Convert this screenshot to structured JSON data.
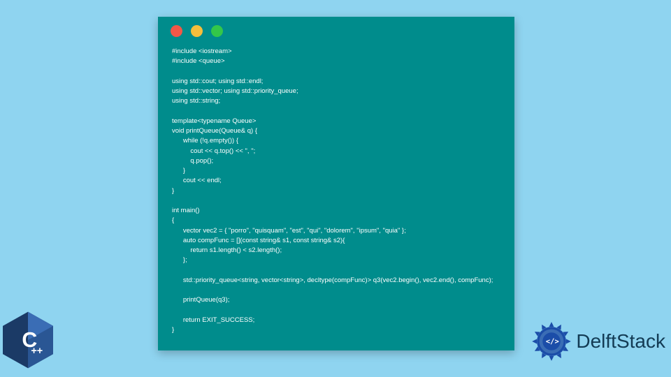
{
  "window": {
    "dots": {
      "red": "#f35747",
      "yellow": "#f6be3c",
      "green": "#33c74a"
    }
  },
  "code": "#include <iostream>\n#include <queue>\n\nusing std::cout; using std::endl;\nusing std::vector; using std::priority_queue;\nusing std::string;\n\ntemplate<typename Queue>\nvoid printQueue(Queue& q) {\n      while (!q.empty()) {\n          cout << q.top() << \", \";\n          q.pop();\n      }\n      cout << endl;\n}\n\nint main()\n{\n      vector vec2 = { \"porro\", \"quisquam\", \"est\", \"qui\", \"dolorem\", \"ipsum\", \"quia\" };\n      auto compFunc = [](const string& s1, const string& s2){\n          return s1.length() < s2.length();\n      };\n\n      std::priority_queue<string, vector<string>, decltype(compFunc)> q3(vec2.begin(), vec2.end(), compFunc);\n\n      printQueue(q3);\n\n      return EXIT_SUCCESS;\n}",
  "badges": {
    "cpp_label": "C",
    "cpp_plus": "++",
    "delft_label": "DelftStack"
  },
  "colors": {
    "page_bg": "#8fd4f0",
    "window_bg": "#008c8c",
    "code_fg": "#ffffff",
    "cpp_blue": "#1b3a66",
    "delft_blue": "#1b4da8",
    "delft_text": "#133b54"
  }
}
